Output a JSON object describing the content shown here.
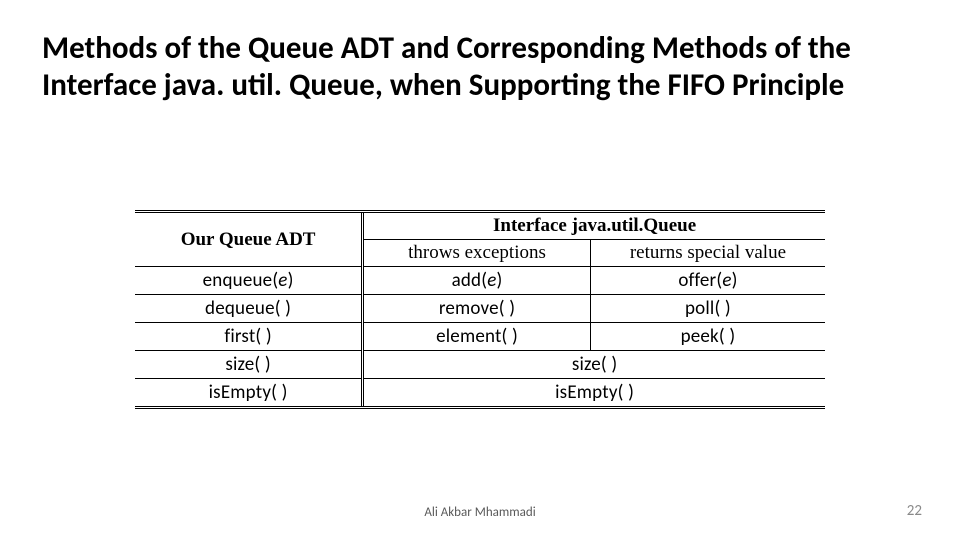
{
  "title": "Methods of the Queue ADT and Corresponding Methods of the Interface java. util. Queue, when Supporting the FIFO Principle",
  "table": {
    "h_adt": "Our Queue ADT",
    "h_iface": "Interface java.util.Queue",
    "h_throws": "throws exceptions",
    "h_returns": "returns special value",
    "rows": [
      {
        "adt_pre": "enqueue(",
        "adt_arg": "e",
        "adt_post": ")",
        "th_pre": "add(",
        "th_arg": "e",
        "th_post": ")",
        "rv_pre": "offer(",
        "rv_arg": "e",
        "rv_post": ")",
        "merge": false
      },
      {
        "adt_pre": "dequeue( )",
        "adt_arg": "",
        "adt_post": "",
        "th_pre": "remove( )",
        "th_arg": "",
        "th_post": "",
        "rv_pre": "poll( )",
        "rv_arg": "",
        "rv_post": "",
        "merge": false
      },
      {
        "adt_pre": "first( )",
        "adt_arg": "",
        "adt_post": "",
        "th_pre": "element( )",
        "th_arg": "",
        "th_post": "",
        "rv_pre": "peek( )",
        "rv_arg": "",
        "rv_post": "",
        "merge": false
      },
      {
        "adt_pre": "size( )",
        "adt_arg": "",
        "adt_post": "",
        "th_pre": "size( )",
        "th_arg": "",
        "th_post": "",
        "rv_pre": "",
        "rv_arg": "",
        "rv_post": "",
        "merge": true
      },
      {
        "adt_pre": "isEmpty( )",
        "adt_arg": "",
        "adt_post": "",
        "th_pre": "isEmpty( )",
        "th_arg": "",
        "th_post": "",
        "rv_pre": "",
        "rv_arg": "",
        "rv_post": "",
        "merge": true
      }
    ]
  },
  "footer_author": "Ali Akbar Mhammadi",
  "footer_page": "22"
}
